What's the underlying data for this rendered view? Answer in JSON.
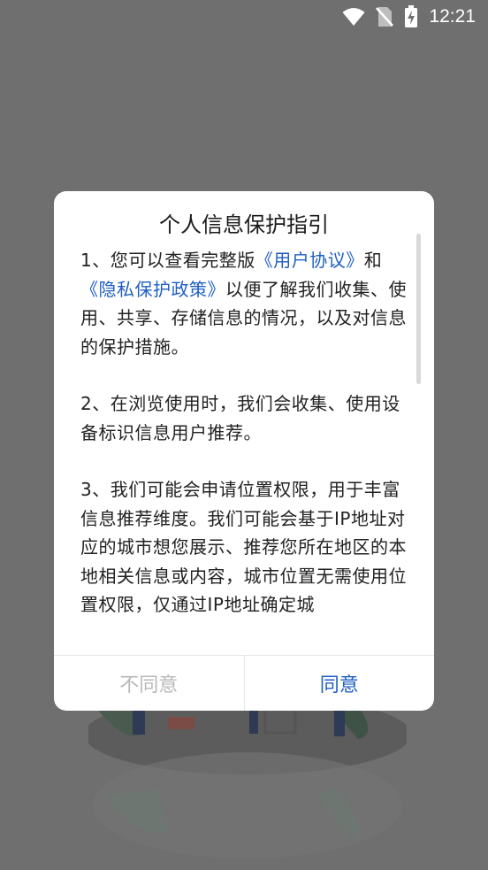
{
  "status_bar": {
    "time": "12:21",
    "icons": [
      "wifi-icon",
      "no-sim-icon",
      "battery-charging-icon"
    ]
  },
  "dialog": {
    "title": "个人信息保护指引",
    "paragraph1": {
      "prefix": "1、您可以查看完整版",
      "link_user_agreement": "《用户协议》",
      "conj": "和",
      "link_privacy_policy": "《隐私保护政策》",
      "suffix": "以便了解我们收集、使用、共享、存储信息的情况，以及对信息的保护措施。"
    },
    "paragraph2": "2、在浏览使用时，我们会收集、使用设备标识信息用户推荐。",
    "paragraph3": "3、我们可能会申请位置权限，用于丰富信息推荐维度。我们可能会基于IP地址对应的城市想您展示、推荐您所在地区的本地相关信息或内容，城市位置无需使用位置权限，仅通过IP地址确定城",
    "buttons": {
      "disagree": "不同意",
      "agree": "同意"
    },
    "colors": {
      "link": "#1e5fc1",
      "disabled_text": "#b8b8b8"
    }
  }
}
